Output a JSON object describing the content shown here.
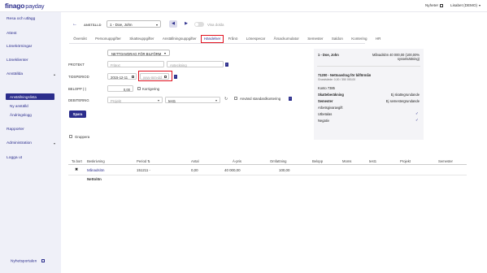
{
  "app": {
    "logo": "finago",
    "logo_suffix": "payday"
  },
  "topbar": {
    "news": "Nyheter",
    "user": "Lisabet (DEMO)"
  },
  "sidebar": {
    "items": [
      {
        "label": "Resa och utlägg"
      },
      {
        "label": "Attest"
      },
      {
        "label": "Lönekörningar"
      },
      {
        "label": "Löneklienter"
      },
      {
        "label": "Anställda"
      }
    ],
    "sub_items": [
      {
        "label": "Anställningslista"
      },
      {
        "label": "Ny anställd"
      },
      {
        "label": "Ändringslogg"
      }
    ],
    "items2": [
      {
        "label": "Rapporter"
      },
      {
        "label": "Administration"
      },
      {
        "label": "Logga ut"
      }
    ],
    "footer": "Nyhetsportalen"
  },
  "header": {
    "employee_label": "ANSTÄLLD",
    "employee_value": "1 - Doe, John",
    "toggle_label": "Visa dolda"
  },
  "tabs": [
    "Översikt",
    "Personuppgifter",
    "Skatteuppgifter",
    "Anställningsuppgifter",
    "Händelser",
    "Frånö",
    "Lönespecar",
    "Årsackumulator",
    "Semester",
    "Saldon",
    "Kontering",
    "HR"
  ],
  "form": {
    "dropdown": "NETTOAVDRAG FÖR BILFÖRM",
    "protect_label": "PROTEKT",
    "protect_placeholder": "Fritext",
    "anteckning_placeholder": "Anteckning",
    "period_label": "TIDSPERIOD",
    "period_from": "2015-12-11",
    "period_to_placeholder": "yyyy-mm-dd",
    "amount_label": "BELOPP (-)",
    "amount_value": "0,00",
    "korrigering": "Korrigering",
    "debit_label": "DEBITERING",
    "project_placeholder": "Projekt",
    "test_value": "test1",
    "std_kontering": "Använd standardkontering",
    "save": "Spara"
  },
  "panel": {
    "name": "1 - Doe, John",
    "salary": "Månadslön 40 000,00 (100,00% sysselsättning)",
    "title": "71200 - Nettoavdrag för bilförmån",
    "sub": "Grundvärde: 0,00 / 350 000,00",
    "konto": "Konto 7385",
    "rows": [
      {
        "label": "Skatteberäkning",
        "value": "Ej skattegrundande"
      },
      {
        "label": "Semester",
        "value": "Ej semestergrundande"
      },
      {
        "label": "Arbetsgivaravgift",
        "value": ""
      },
      {
        "label": "Utbetalas",
        "value": ""
      },
      {
        "label": "Negativ",
        "value": ""
      }
    ]
  },
  "group_label": "Gruppera",
  "table": {
    "headers": [
      "Ta bort",
      "Beskrivning",
      "Period",
      "Antal",
      "Á-pris",
      "Omfattning",
      "Belopp",
      "Moms",
      "test1",
      "Projekt",
      "Semester"
    ],
    "rows": [
      {
        "delete": "✖",
        "desc": "Månadslön",
        "period": "151211 -",
        "antal": "0,00",
        "apris": "40 000,00",
        "omf": "100,00"
      }
    ],
    "footer": "Nettolön"
  }
}
